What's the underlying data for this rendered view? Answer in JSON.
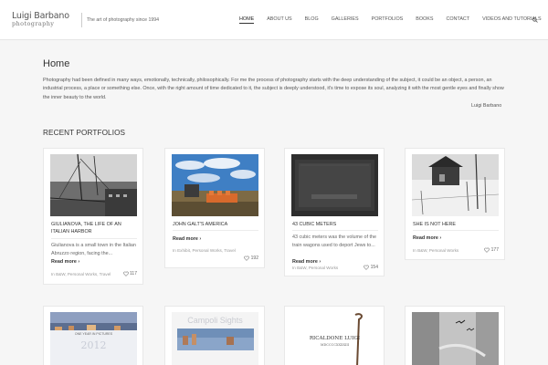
{
  "header": {
    "logo_name": "Luigi Barbano",
    "logo_sub": "photography",
    "tagline": "The art of photography since 1994",
    "nav": [
      "HOME",
      "ABOUT US",
      "BLOG",
      "GALLERIES",
      "PORTFOLIOS",
      "BOOKS",
      "CONTACT",
      "VIDEOS AND TUTORIALS"
    ],
    "search_icon": "search-icon"
  },
  "page": {
    "title": "Home",
    "intro": "Photography had been defined in many ways, emotionally, technically, philosophically. For me the process of photography starts with the deep understanding of the subject, it could be an object, a person, an industrial process, a place or something else. Once, with the right amount of time dedicated to it, the subject is deeply understood, it's time to expose its soul, analyzing it with the most gentle eyes and finally show the inner beauty to the world.",
    "signature": "Luigi Barbano",
    "section_title": "RECENT PORTFOLIOS"
  },
  "cards": [
    {
      "title": "GIULIANOVA, THE LIFE OF AN ITALIAN HARBOR",
      "excerpt": "Giulianova is a small town in the Italian Abruzzo region, facing the...",
      "read_more": "Read more ›",
      "meta": "In B&W, Personal Works, Travel",
      "likes": "117"
    },
    {
      "title": "JOHN GALT'S AMERICA",
      "excerpt": "",
      "read_more": "Read more ›",
      "meta": "In Exhibit, Personal Works, Travel",
      "likes": "192"
    },
    {
      "title": "43 CUBIC METERS",
      "excerpt": "43 cubic meters was the volume of the train wagons used to deport Jews to...",
      "read_more": "Read more ›",
      "meta": "In B&W, Personal Works",
      "likes": "154"
    },
    {
      "title": "SHE IS NOT HERE",
      "excerpt": "",
      "read_more": "Read more ›",
      "meta": "In B&W, Personal Works",
      "likes": "177"
    }
  ],
  "cards_row2": [
    {
      "img_text": "2012",
      "img_sub": "ONE YEAR IN PICTURES"
    },
    {
      "img_text": "Campoli Sights",
      "img_sub": ""
    },
    {
      "img_text": "RICALDONE LUIGI",
      "img_sub": "MDCCCCXXXXIII"
    },
    {
      "img_text": "",
      "img_sub": ""
    }
  ]
}
